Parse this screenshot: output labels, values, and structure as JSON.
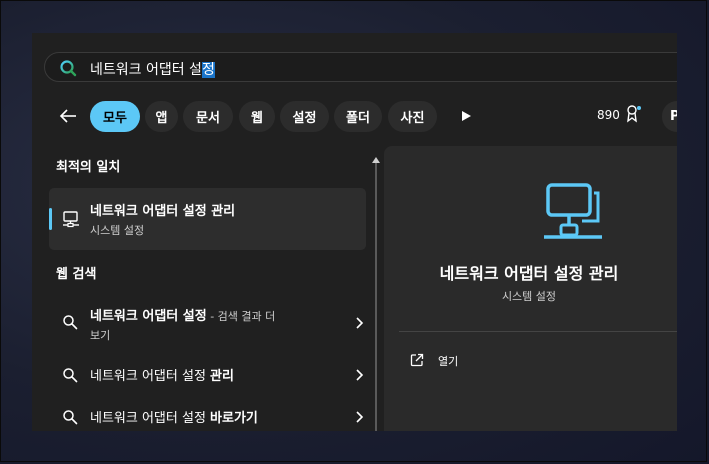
{
  "search": {
    "value_plain": "네트워크 어댑터 설",
    "value_selected": "정"
  },
  "filters": [
    {
      "label": "모두",
      "active": true
    },
    {
      "label": "앱"
    },
    {
      "label": "문서"
    },
    {
      "label": "웹"
    },
    {
      "label": "설정"
    },
    {
      "label": "폴더"
    },
    {
      "label": "사진"
    }
  ],
  "header": {
    "points": "890",
    "profile_initial": "P"
  },
  "best_match": {
    "section_title": "최적의 일치",
    "title": "네트워크 어댑터 설정 관리",
    "subtitle": "시스템 설정"
  },
  "web_search": {
    "section_title": "웹 검색",
    "items": [
      {
        "main": "네트워크 어댑터 설정",
        "suffix": " - 검색 결과 더",
        "continuation": "보기"
      },
      {
        "main": "네트워크 어댑터 설정 ",
        "bold": "관리"
      },
      {
        "main": "네트워크 어댑터 설정 ",
        "bold": "바로가기"
      }
    ]
  },
  "detail": {
    "title": "네트워크 어댑터 설정 관리",
    "subtitle": "시스템 설정",
    "action_open": "열기"
  },
  "icons": {
    "search": "search-icon",
    "back": "back-arrow-icon",
    "more": "play-icon",
    "award": "award-icon",
    "settings": "network-monitor-icon",
    "web": "magnifier-icon",
    "chevron": "chevron-right-icon",
    "open": "open-external-icon"
  },
  "colors": {
    "accent": "#5cc8f6",
    "selection": "#1a74c9",
    "panel": "#202020",
    "detail": "#2a2a2a"
  }
}
